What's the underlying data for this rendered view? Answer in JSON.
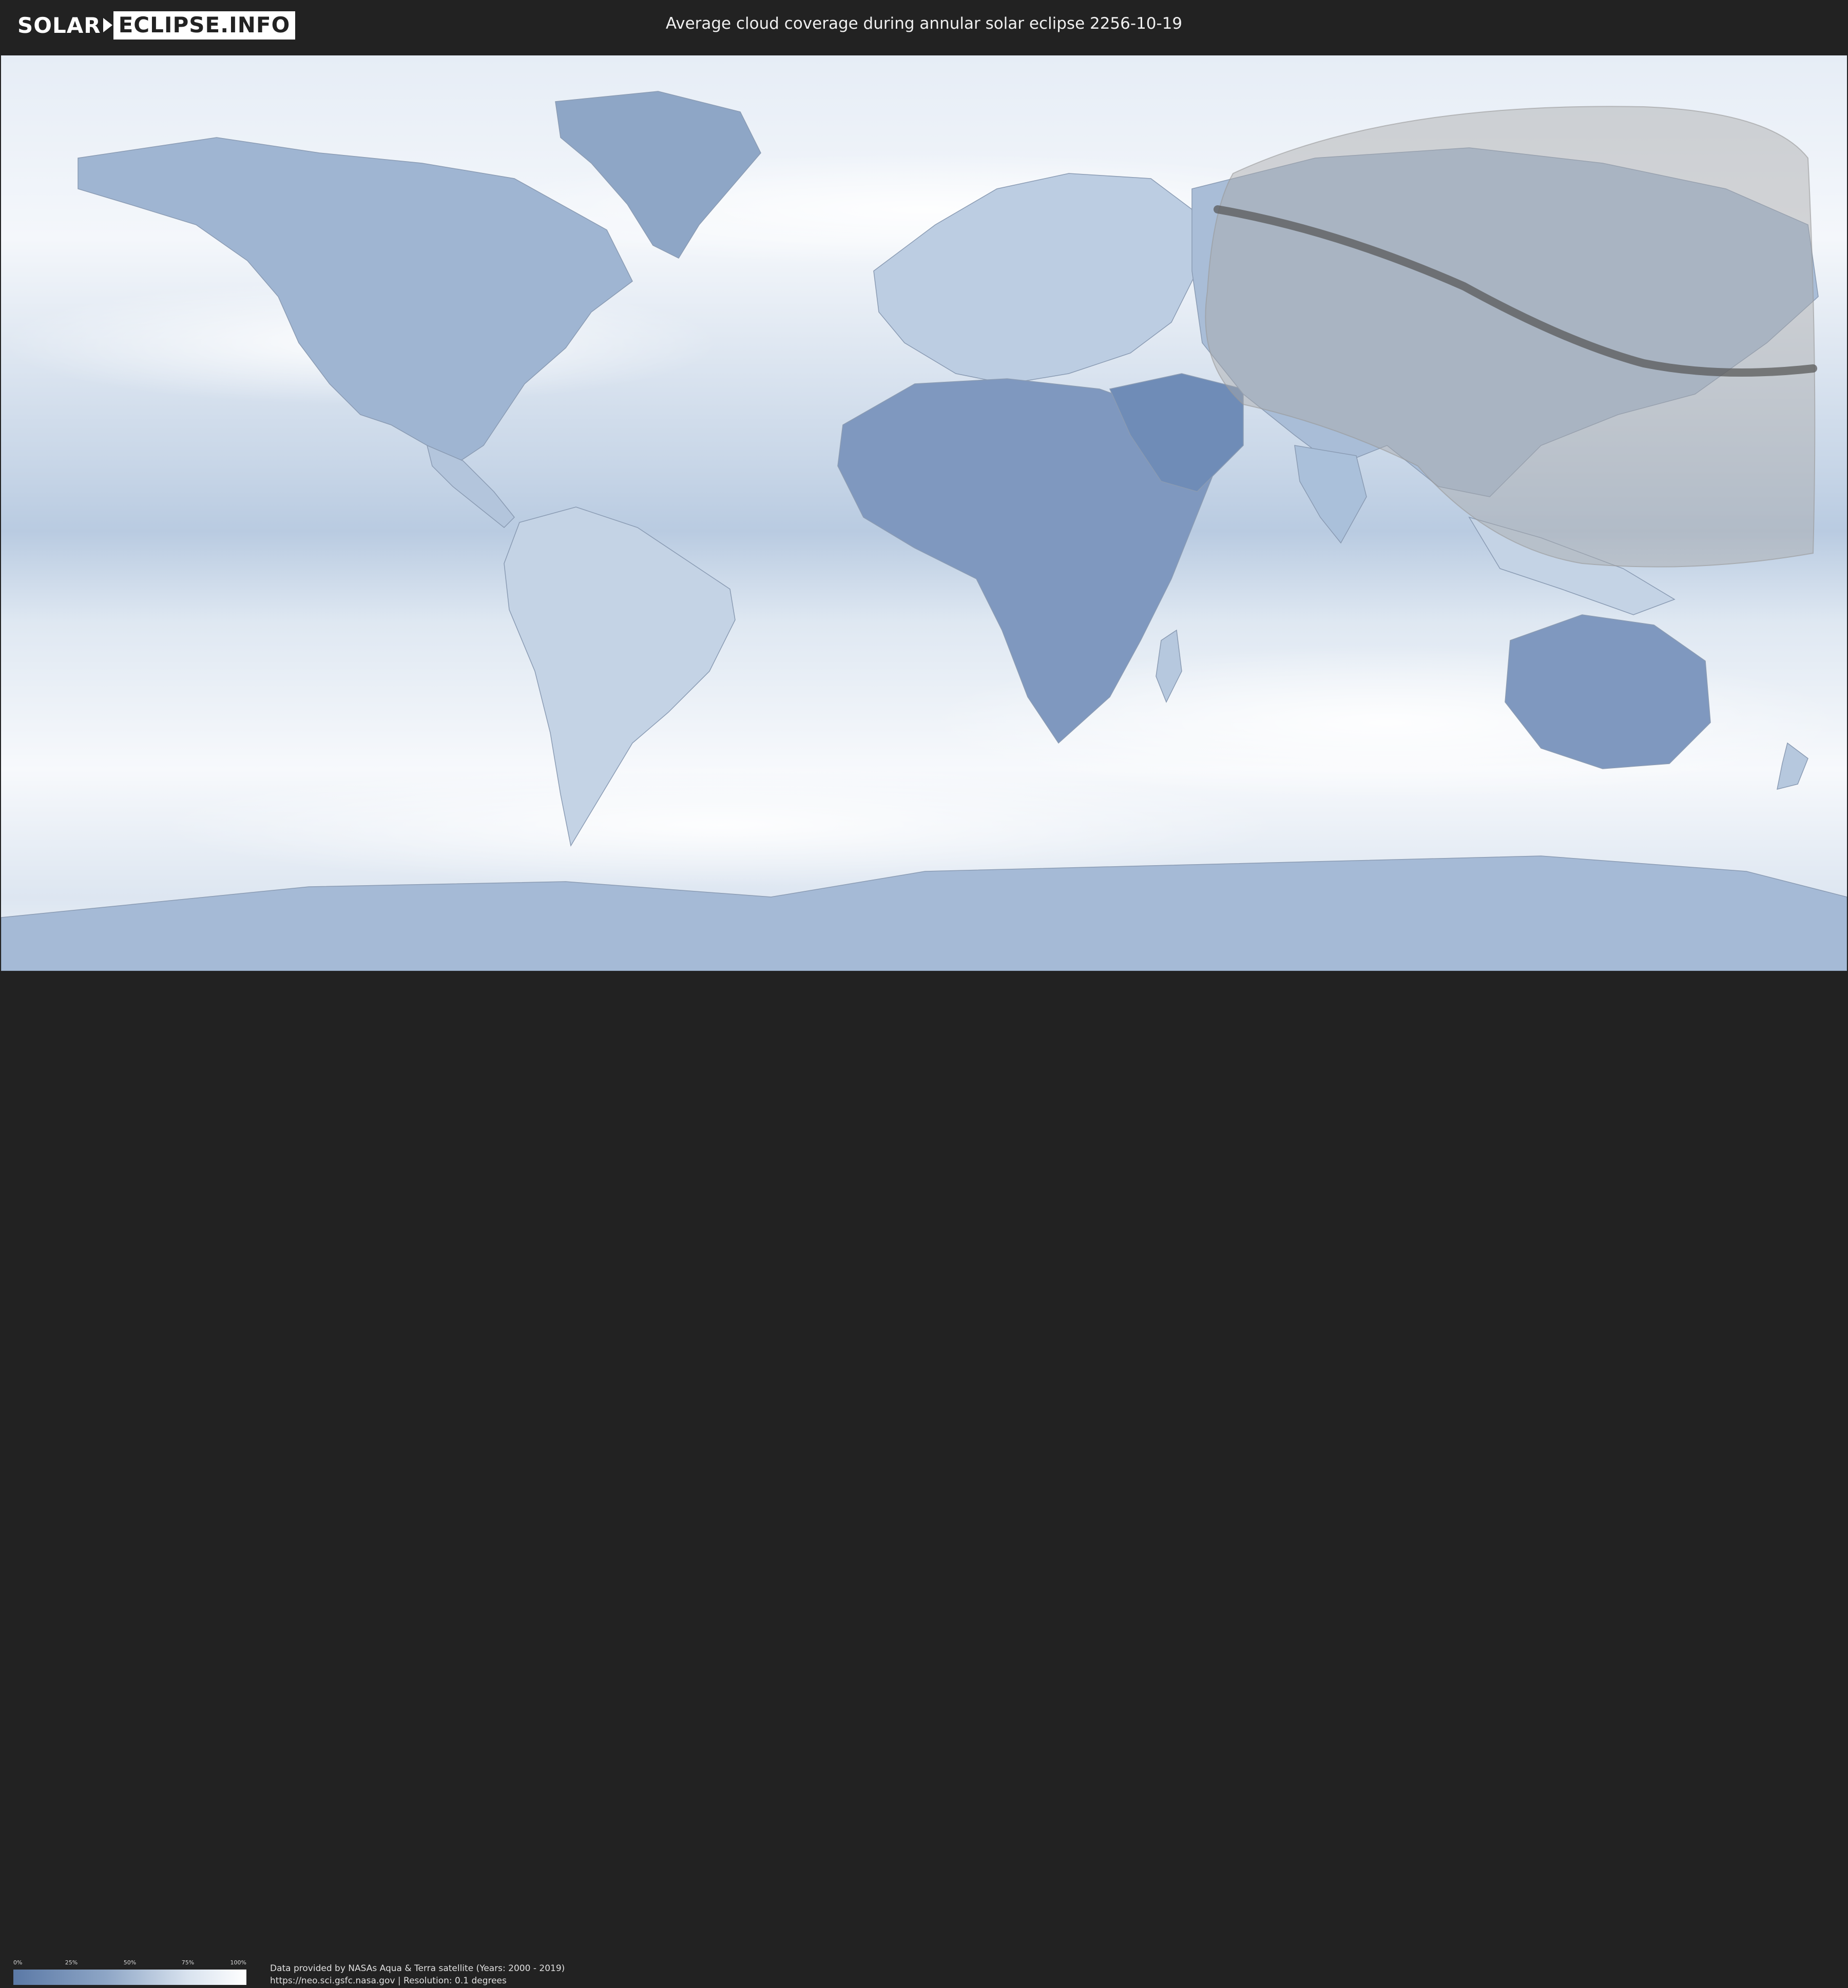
{
  "header": {
    "logo_part1": "SOLAR",
    "logo_part2": "ECLIPSE.INFO",
    "title": "Average cloud coverage during annular solar eclipse 2256-10-19"
  },
  "legend": {
    "ticks": [
      "0%",
      "25%",
      "50%",
      "75%",
      "100%"
    ],
    "tick_values": [
      0,
      0.25,
      0.5,
      0.75,
      1
    ],
    "gradient_colors": [
      "#5b79a6",
      "#8ea6c6",
      "#d9e3ef",
      "#ffffff"
    ]
  },
  "credits": {
    "line1": "Data provided by NASAs Aqua & Terra satellite (Years: 2000 - 2019)",
    "line2": "https://neo.sci.gsfc.nasa.gov | Resolution: 0.1 degrees"
  },
  "colors": {
    "background": "#222222",
    "ocean_cloud": "#eef3f9",
    "clear_land": "#6f8cb7",
    "eclipse_visibility": "#a8a8a8",
    "eclipse_path": "#5a5a5a"
  },
  "icons": [
    "solar-eclipse-logo-icon"
  ]
}
